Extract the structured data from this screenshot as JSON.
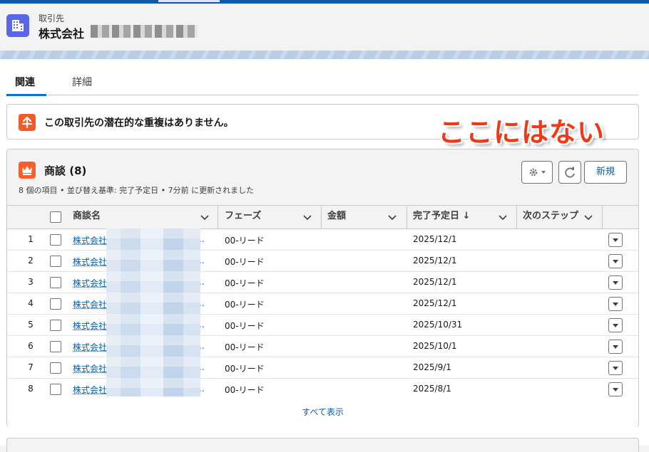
{
  "header": {
    "object_type": "取引先",
    "record_name": "株式会社"
  },
  "tabs": [
    {
      "label": "関連"
    },
    {
      "label": "詳細"
    }
  ],
  "duplicate_notice": {
    "text": "この取引先の潜在的な重複はありません。"
  },
  "annotation": {
    "text": "ここにはない",
    "color": "#ef3a17"
  },
  "opportunities": {
    "title": "商談 (8)",
    "subtitle": "8 個の項目 • 並び替え基準: 完了予定日 • 7分前 に更新されました",
    "new_button": "新規",
    "columns": [
      "商談名",
      "フェーズ",
      "金額",
      "完了予定日 ↓",
      "次のステップ"
    ],
    "rows": [
      {
        "num": "1",
        "name": "株式会社",
        "ellipsis": "..",
        "phase": "00-リード",
        "amount": "",
        "close_date": "2025/12/1",
        "next_step": ""
      },
      {
        "num": "2",
        "name": "株式会社",
        "ellipsis": "..",
        "phase": "00-リード",
        "amount": "",
        "close_date": "2025/12/1",
        "next_step": ""
      },
      {
        "num": "3",
        "name": "株式会社",
        "ellipsis": "..",
        "phase": "00-リード",
        "amount": "",
        "close_date": "2025/12/1",
        "next_step": ""
      },
      {
        "num": "4",
        "name": "株式会社",
        "ellipsis": "..",
        "phase": "00-リード",
        "amount": "",
        "close_date": "2025/12/1",
        "next_step": ""
      },
      {
        "num": "5",
        "name": "株式会社",
        "ellipsis": "..",
        "phase": "00-リード",
        "amount": "",
        "close_date": "2025/10/31",
        "next_step": ""
      },
      {
        "num": "6",
        "name": "株式会社",
        "ellipsis": "..",
        "phase": "00-リード",
        "amount": "",
        "close_date": "2025/10/1",
        "next_step": ""
      },
      {
        "num": "7",
        "name": "株式会社",
        "ellipsis": "..",
        "phase": "00-リード",
        "amount": "",
        "close_date": "2025/9/1",
        "next_step": ""
      },
      {
        "num": "8",
        "name": "株式会社",
        "ellipsis": "..",
        "phase": "00-リード",
        "amount": "",
        "close_date": "2025/8/1",
        "next_step": ""
      }
    ],
    "view_all": "すべて表示"
  },
  "colors": {
    "brand": "#0176d3",
    "link": "#0b5cab",
    "object_icon": "#5867e8",
    "opportunity_icon": "#ff5d2d",
    "duplicate_icon": "#f15a29"
  },
  "icons": [
    "account-building-icon",
    "duplicate-merge-icon",
    "opportunity-crown-icon",
    "gear-icon",
    "chevron-down-icon",
    "refresh-icon",
    "row-action-icon"
  ]
}
